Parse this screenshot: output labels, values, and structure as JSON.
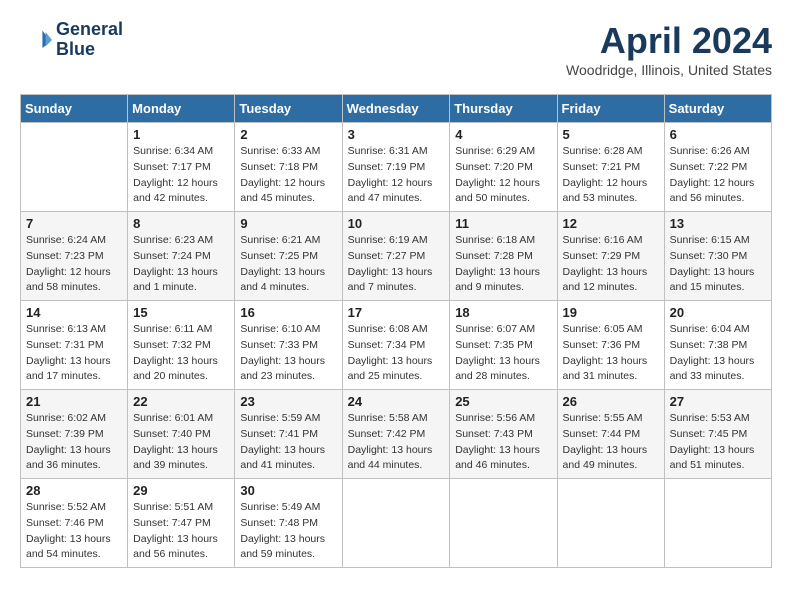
{
  "header": {
    "logo_line1": "General",
    "logo_line2": "Blue",
    "month_title": "April 2024",
    "location": "Woodridge, Illinois, United States"
  },
  "days_of_week": [
    "Sunday",
    "Monday",
    "Tuesday",
    "Wednesday",
    "Thursday",
    "Friday",
    "Saturday"
  ],
  "weeks": [
    [
      {
        "date": "",
        "sunrise": "",
        "sunset": "",
        "daylight": ""
      },
      {
        "date": "1",
        "sunrise": "Sunrise: 6:34 AM",
        "sunset": "Sunset: 7:17 PM",
        "daylight": "Daylight: 12 hours and 42 minutes."
      },
      {
        "date": "2",
        "sunrise": "Sunrise: 6:33 AM",
        "sunset": "Sunset: 7:18 PM",
        "daylight": "Daylight: 12 hours and 45 minutes."
      },
      {
        "date": "3",
        "sunrise": "Sunrise: 6:31 AM",
        "sunset": "Sunset: 7:19 PM",
        "daylight": "Daylight: 12 hours and 47 minutes."
      },
      {
        "date": "4",
        "sunrise": "Sunrise: 6:29 AM",
        "sunset": "Sunset: 7:20 PM",
        "daylight": "Daylight: 12 hours and 50 minutes."
      },
      {
        "date": "5",
        "sunrise": "Sunrise: 6:28 AM",
        "sunset": "Sunset: 7:21 PM",
        "daylight": "Daylight: 12 hours and 53 minutes."
      },
      {
        "date": "6",
        "sunrise": "Sunrise: 6:26 AM",
        "sunset": "Sunset: 7:22 PM",
        "daylight": "Daylight: 12 hours and 56 minutes."
      }
    ],
    [
      {
        "date": "7",
        "sunrise": "Sunrise: 6:24 AM",
        "sunset": "Sunset: 7:23 PM",
        "daylight": "Daylight: 12 hours and 58 minutes."
      },
      {
        "date": "8",
        "sunrise": "Sunrise: 6:23 AM",
        "sunset": "Sunset: 7:24 PM",
        "daylight": "Daylight: 13 hours and 1 minute."
      },
      {
        "date": "9",
        "sunrise": "Sunrise: 6:21 AM",
        "sunset": "Sunset: 7:25 PM",
        "daylight": "Daylight: 13 hours and 4 minutes."
      },
      {
        "date": "10",
        "sunrise": "Sunrise: 6:19 AM",
        "sunset": "Sunset: 7:27 PM",
        "daylight": "Daylight: 13 hours and 7 minutes."
      },
      {
        "date": "11",
        "sunrise": "Sunrise: 6:18 AM",
        "sunset": "Sunset: 7:28 PM",
        "daylight": "Daylight: 13 hours and 9 minutes."
      },
      {
        "date": "12",
        "sunrise": "Sunrise: 6:16 AM",
        "sunset": "Sunset: 7:29 PM",
        "daylight": "Daylight: 13 hours and 12 minutes."
      },
      {
        "date": "13",
        "sunrise": "Sunrise: 6:15 AM",
        "sunset": "Sunset: 7:30 PM",
        "daylight": "Daylight: 13 hours and 15 minutes."
      }
    ],
    [
      {
        "date": "14",
        "sunrise": "Sunrise: 6:13 AM",
        "sunset": "Sunset: 7:31 PM",
        "daylight": "Daylight: 13 hours and 17 minutes."
      },
      {
        "date": "15",
        "sunrise": "Sunrise: 6:11 AM",
        "sunset": "Sunset: 7:32 PM",
        "daylight": "Daylight: 13 hours and 20 minutes."
      },
      {
        "date": "16",
        "sunrise": "Sunrise: 6:10 AM",
        "sunset": "Sunset: 7:33 PM",
        "daylight": "Daylight: 13 hours and 23 minutes."
      },
      {
        "date": "17",
        "sunrise": "Sunrise: 6:08 AM",
        "sunset": "Sunset: 7:34 PM",
        "daylight": "Daylight: 13 hours and 25 minutes."
      },
      {
        "date": "18",
        "sunrise": "Sunrise: 6:07 AM",
        "sunset": "Sunset: 7:35 PM",
        "daylight": "Daylight: 13 hours and 28 minutes."
      },
      {
        "date": "19",
        "sunrise": "Sunrise: 6:05 AM",
        "sunset": "Sunset: 7:36 PM",
        "daylight": "Daylight: 13 hours and 31 minutes."
      },
      {
        "date": "20",
        "sunrise": "Sunrise: 6:04 AM",
        "sunset": "Sunset: 7:38 PM",
        "daylight": "Daylight: 13 hours and 33 minutes."
      }
    ],
    [
      {
        "date": "21",
        "sunrise": "Sunrise: 6:02 AM",
        "sunset": "Sunset: 7:39 PM",
        "daylight": "Daylight: 13 hours and 36 minutes."
      },
      {
        "date": "22",
        "sunrise": "Sunrise: 6:01 AM",
        "sunset": "Sunset: 7:40 PM",
        "daylight": "Daylight: 13 hours and 39 minutes."
      },
      {
        "date": "23",
        "sunrise": "Sunrise: 5:59 AM",
        "sunset": "Sunset: 7:41 PM",
        "daylight": "Daylight: 13 hours and 41 minutes."
      },
      {
        "date": "24",
        "sunrise": "Sunrise: 5:58 AM",
        "sunset": "Sunset: 7:42 PM",
        "daylight": "Daylight: 13 hours and 44 minutes."
      },
      {
        "date": "25",
        "sunrise": "Sunrise: 5:56 AM",
        "sunset": "Sunset: 7:43 PM",
        "daylight": "Daylight: 13 hours and 46 minutes."
      },
      {
        "date": "26",
        "sunrise": "Sunrise: 5:55 AM",
        "sunset": "Sunset: 7:44 PM",
        "daylight": "Daylight: 13 hours and 49 minutes."
      },
      {
        "date": "27",
        "sunrise": "Sunrise: 5:53 AM",
        "sunset": "Sunset: 7:45 PM",
        "daylight": "Daylight: 13 hours and 51 minutes."
      }
    ],
    [
      {
        "date": "28",
        "sunrise": "Sunrise: 5:52 AM",
        "sunset": "Sunset: 7:46 PM",
        "daylight": "Daylight: 13 hours and 54 minutes."
      },
      {
        "date": "29",
        "sunrise": "Sunrise: 5:51 AM",
        "sunset": "Sunset: 7:47 PM",
        "daylight": "Daylight: 13 hours and 56 minutes."
      },
      {
        "date": "30",
        "sunrise": "Sunrise: 5:49 AM",
        "sunset": "Sunset: 7:48 PM",
        "daylight": "Daylight: 13 hours and 59 minutes."
      },
      {
        "date": "",
        "sunrise": "",
        "sunset": "",
        "daylight": ""
      },
      {
        "date": "",
        "sunrise": "",
        "sunset": "",
        "daylight": ""
      },
      {
        "date": "",
        "sunrise": "",
        "sunset": "",
        "daylight": ""
      },
      {
        "date": "",
        "sunrise": "",
        "sunset": "",
        "daylight": ""
      }
    ]
  ]
}
